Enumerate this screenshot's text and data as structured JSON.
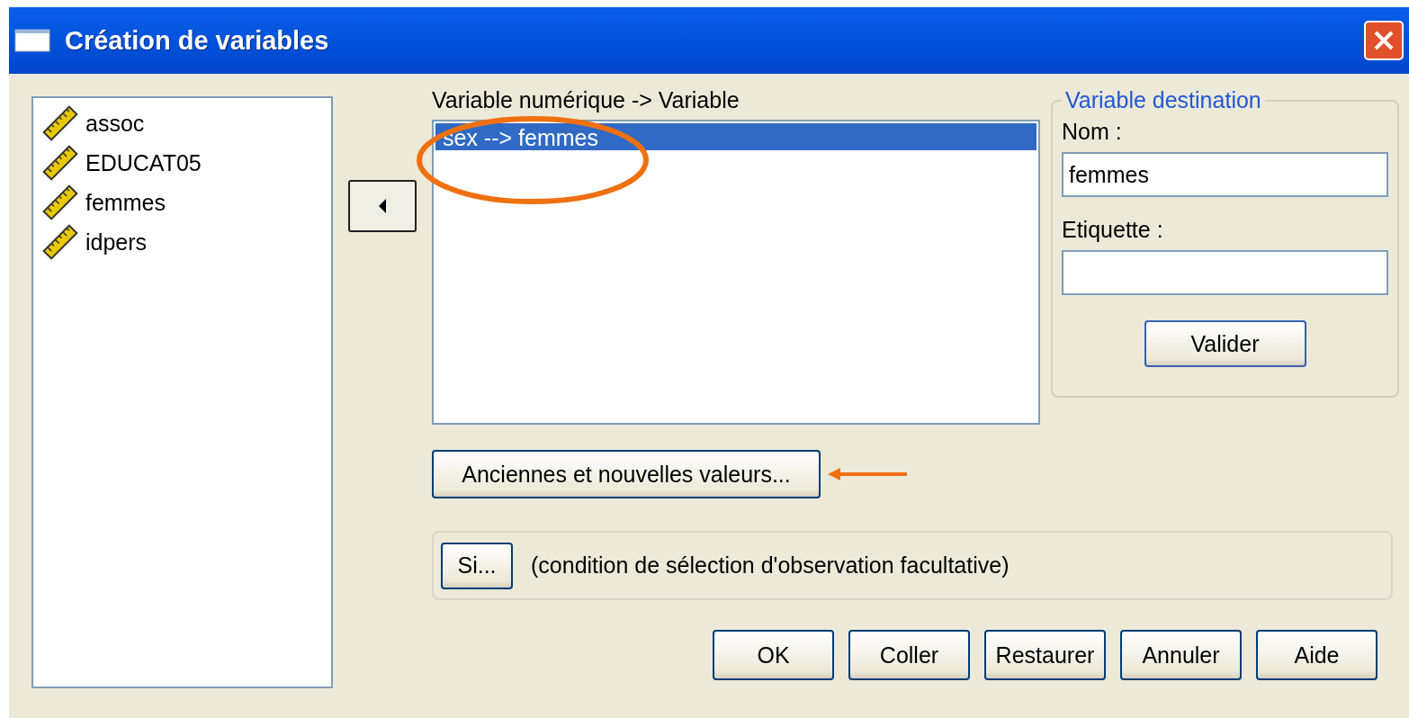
{
  "window": {
    "title": "Création de variables"
  },
  "variables": [
    {
      "name": "assoc",
      "selected": false
    },
    {
      "name": "EDUCAT05",
      "selected": false
    },
    {
      "name": "femmes",
      "selected": false
    },
    {
      "name": "idpers",
      "selected": false
    }
  ],
  "mapping": {
    "label": "Variable numérique -> Variable",
    "items": [
      {
        "text": "sex --> femmes",
        "selected": true
      }
    ]
  },
  "destination": {
    "legend": "Variable destination",
    "name_label": "Nom :",
    "name_value": "femmes",
    "label_label": "Etiquette :",
    "validate_button": "Valider"
  },
  "values_button": "Anciennes et nouvelles valeurs...",
  "condition": {
    "button": "Si...",
    "text": "(condition de sélection d'observation facultative)"
  },
  "buttons": [
    "OK",
    "Coller",
    "Restaurer",
    "Annuler",
    "Aide"
  ]
}
